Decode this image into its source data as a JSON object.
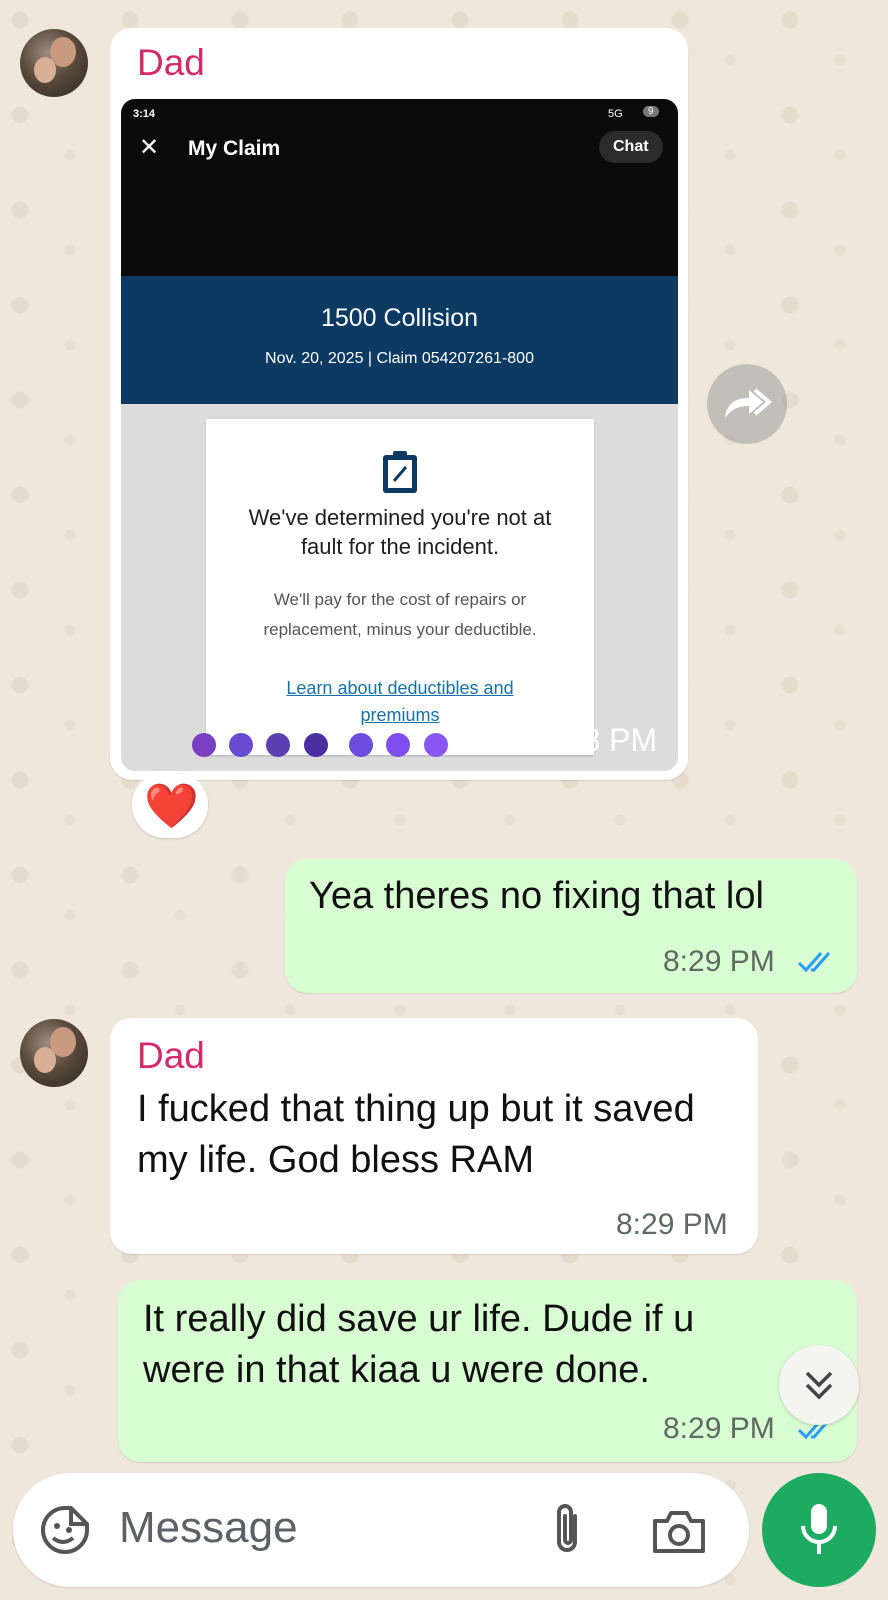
{
  "messages": [
    {
      "sender": "Dad",
      "type": "image",
      "time": "8:28 PM",
      "reaction": "❤️",
      "screenshot": {
        "status_time": "3:14",
        "status_network": "5G",
        "status_battery": "9",
        "title": "My Claim",
        "chat_button": "Chat",
        "header_title": "1500 Collision",
        "header_subtitle": "Nov. 20, 2025 | Claim 054207261-800",
        "card_heading": "We've determined you're not at fault for the incident.",
        "card_body": "We'll pay for the cost of repairs or replacement, minus your deductible.",
        "card_link": "Learn about deductibles and premiums"
      }
    },
    {
      "type": "outgoing",
      "text": "Yea theres no fixing that lol",
      "time": "8:29 PM"
    },
    {
      "sender": "Dad",
      "type": "incoming",
      "text": "I fucked that thing up but it saved my life. God bless RAM",
      "time": "8:29 PM"
    },
    {
      "type": "outgoing",
      "text": "It really did save ur life. Dude if u were in that kiaa u were done.",
      "time": "8:29 PM"
    }
  ],
  "composer": {
    "placeholder": "Message"
  },
  "colors": {
    "sender": "#d42a6b",
    "outgoing_bubble": "#d9fdd3",
    "mic_button": "#1daa61",
    "read_tick": "#2a9df4",
    "claim_header": "#0c3a63"
  },
  "icons": {
    "forward": "forward-icon",
    "scroll_down": "double-chevron-down-icon",
    "sticker": "sticker-icon",
    "attach": "paperclip-icon",
    "camera": "camera-icon",
    "mic": "mic-icon"
  }
}
